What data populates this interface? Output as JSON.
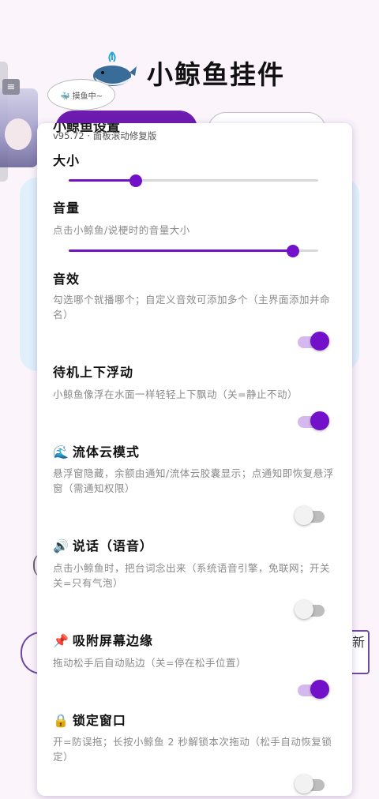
{
  "app": {
    "title": "小鲸鱼挂件",
    "bubble_text": "🐳 摸鱼中~",
    "menu_icon": "≡",
    "side_button_text": "新"
  },
  "panel": {
    "cut_title": "小鲸鱼设置",
    "version": "v95.72 · 面板滚动修复版",
    "size": {
      "title": "大小",
      "value": 0.27
    },
    "volume": {
      "title": "音量",
      "desc": "点击小鲸鱼/说梗时的音量大小",
      "value": 0.9
    },
    "sound_effect": {
      "title": "音效",
      "desc": "勾选哪个就播哪个；自定义音效可添加多个（主界面添加并命名）",
      "on": true
    },
    "float": {
      "title": "待机上下浮动",
      "desc": "小鲸鱼像浮在水面一样轻轻上下飘动（关=静止不动）",
      "on": true
    },
    "fluid_cloud": {
      "icon": "🌊",
      "title": "流体云模式",
      "desc": "悬浮窗隐藏，余额由通知/流体云胶囊显示；点通知即恢复悬浮窗（需通知权限）",
      "on": false
    },
    "speech": {
      "icon": "🔊",
      "title": "说话（语音）",
      "desc": "点击小鲸鱼时，把台词念出来（系统语音引擎，免联网；开关关=只有气泡）",
      "on": false
    },
    "snap_edge": {
      "icon": "📌",
      "title": "吸附屏幕边缘",
      "desc": "拖动松手后自动贴边（关=停在松手位置）",
      "on": true
    },
    "lock_window": {
      "icon": "🔒",
      "title": "锁定窗口",
      "desc": "开=防误拖；长按小鲸鱼 2 秒解锁本次拖动（松手自动恢复锁定）",
      "on": false
    }
  }
}
